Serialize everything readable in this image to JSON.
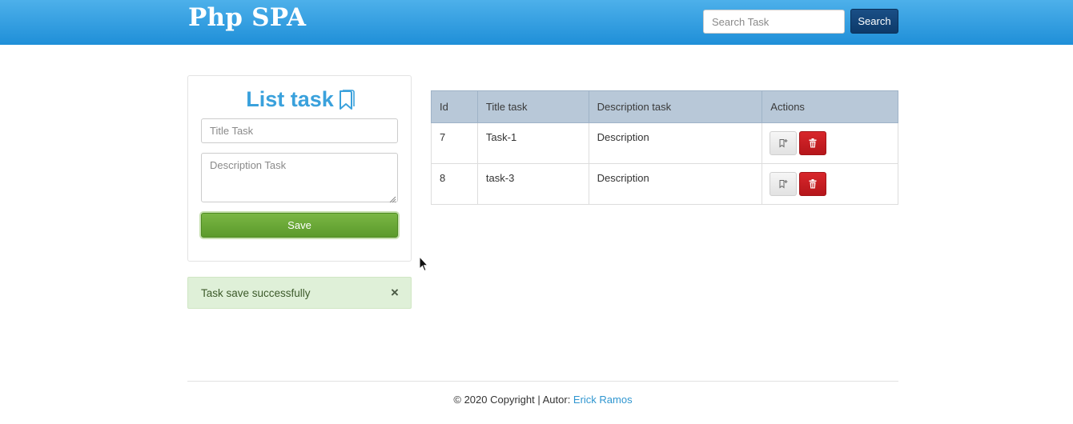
{
  "app": {
    "brand": "Php SPA"
  },
  "search": {
    "placeholder": "Search Task",
    "value": "",
    "button_label": "Search"
  },
  "form": {
    "title": "List task",
    "title_placeholder": "Title Task",
    "description_placeholder": "Description Task",
    "save_label": "Save"
  },
  "alert": {
    "message": "Task save successfully",
    "close_symbol": "×"
  },
  "table": {
    "headers": {
      "id": "Id",
      "title": "Title task",
      "description": "Description task",
      "actions": "Actions"
    },
    "rows": [
      {
        "id": "7",
        "title": "Task-1",
        "description": "Description"
      },
      {
        "id": "8",
        "title": "task-3",
        "description": "Description"
      }
    ]
  },
  "footer": {
    "text": "© 2020 Copyright | Autor: ",
    "author": "Erick Ramos"
  },
  "colors": {
    "navbar": "#1f8fd8",
    "accent": "#3aa1dc",
    "save": "#5b9a2b",
    "delete": "#c21d22",
    "alert_bg": "#dff0d8",
    "table_header": "#b8c8d8"
  },
  "icons": {
    "title": "bookmark-icon",
    "edit": "bookmark-plus-icon",
    "delete": "trash-icon",
    "alert_close": "close-icon",
    "textarea": "resize-grip-icon"
  }
}
